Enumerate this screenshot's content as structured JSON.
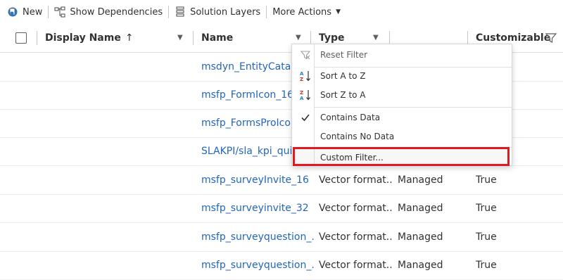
{
  "toolbar": {
    "new_label": "New",
    "show_dependencies_label": "Show Dependencies",
    "solution_layers_label": "Solution Layers",
    "more_actions_label": "More Actions"
  },
  "header": {
    "display_name": "Display Name",
    "sort_arrow": "↑",
    "name": "Name",
    "type": "Type",
    "customizable": "Customizable"
  },
  "rows": [
    {
      "name": "msdyn_EntityCatalog",
      "type": "",
      "managed": "",
      "customizable": ""
    },
    {
      "name": "msfp_FormIcon_16_1",
      "type": "",
      "managed": "",
      "customizable": ""
    },
    {
      "name": "msfp_FormsProIcon_",
      "type": "",
      "managed": "",
      "customizable": ""
    },
    {
      "name": "SLAKPI/sla_kpi_quick",
      "type": "",
      "managed": "",
      "customizable": ""
    },
    {
      "name": "msfp_surveyInvite_16",
      "type": "Vector format...",
      "managed": "Managed",
      "customizable": "True"
    },
    {
      "name": "msfp_surveyinvite_32",
      "type": "Vector format...",
      "managed": "Managed",
      "customizable": "True"
    },
    {
      "name": "msfp_surveyquestion_...",
      "type": "Vector format...",
      "managed": "Managed",
      "customizable": "True"
    },
    {
      "name": "msfp_surveyquestion_...",
      "type": "Vector format...",
      "managed": "Managed",
      "customizable": "True"
    }
  ],
  "menu": {
    "reset_filter": "Reset Filter",
    "sort_a_to_z": "Sort A to Z",
    "sort_z_to_a": "Sort Z to A",
    "contains_data": "Contains Data",
    "contains_no_data": "Contains No Data",
    "custom_filter": "Custom Filter..."
  },
  "colors": {
    "link": "#2266bb",
    "highlight_border": "#e0191e"
  }
}
